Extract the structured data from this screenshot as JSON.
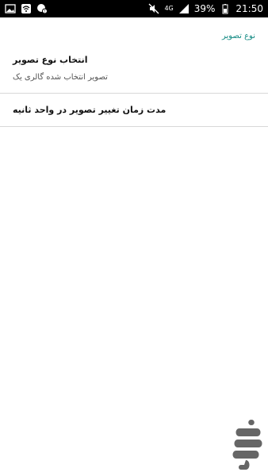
{
  "status_bar": {
    "network": "4G",
    "battery": "39%",
    "time": "21:50",
    "left_icons": [
      "gallery-icon",
      "wifi-alt-icon",
      "chat-alert-icon"
    ],
    "right_icons": [
      "mute-icon",
      "signal-icon",
      "battery-icon"
    ]
  },
  "preferences": {
    "section_title": "نوع تصویر",
    "items": [
      {
        "title": "انتخاب نوع تصویر",
        "summary": "تصویر انتخاب شده گالری یک"
      },
      {
        "title": "مدت زمان تغییر تصویر در واحد ثانیه",
        "summary": ""
      }
    ]
  },
  "colors": {
    "accent": "#138a83",
    "divider": "#d8d8d8",
    "status_bar": "#000000",
    "background": "#ffffff"
  }
}
